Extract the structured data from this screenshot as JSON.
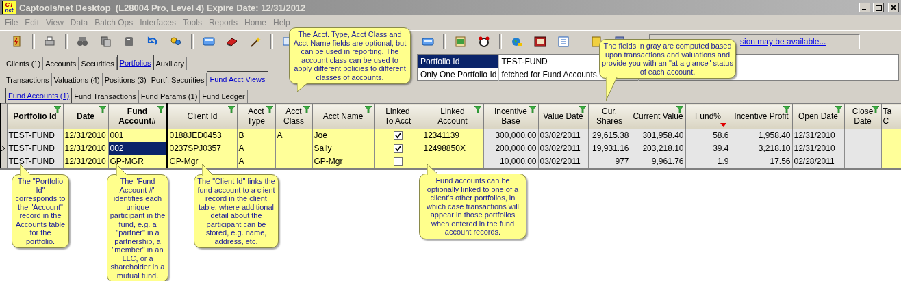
{
  "window": {
    "logo": {
      "top": "CT",
      "bottom": "net"
    },
    "title": "Captools/net Desktop  (L28004 Pro, Level 4) Expire Date: 12/31/2012"
  },
  "menu": [
    "File",
    "Edit",
    "View",
    "Data",
    "Batch Ops",
    "Interfaces",
    "Tools",
    "Reports",
    "Home",
    "Help"
  ],
  "update_link": "sion may be available...",
  "main_tabs": [
    {
      "label": "Clients (1)",
      "selected": false
    },
    {
      "label": "Accounts",
      "selected": false
    },
    {
      "label": "Securities",
      "selected": false
    },
    {
      "label": "Portfolios",
      "selected": true
    },
    {
      "label": "Auxiliary",
      "selected": false
    }
  ],
  "portfolio_tabs": [
    {
      "label": "Transactions",
      "selected": false
    },
    {
      "label": "Valuations (4)",
      "selected": false
    },
    {
      "label": "Positions (3)",
      "selected": false
    },
    {
      "label": "Portf. Securities",
      "selected": false
    },
    {
      "label": "Fund Acct Views",
      "selected": true
    }
  ],
  "info_panel": [
    {
      "label": "Portfolio Id",
      "value": "TEST-FUND",
      "selected": true
    },
    {
      "label": "Only One Portfolio Id",
      "value": "fetched for Fund Accounts.",
      "selected": false
    }
  ],
  "fund_tabs": [
    {
      "label": "Fund Accounts (1)",
      "selected": true
    },
    {
      "label": "Fund Transactions",
      "selected": false
    },
    {
      "label": "Fund Params (1)",
      "selected": false
    },
    {
      "label": "Fund Ledger",
      "selected": false
    }
  ],
  "table": {
    "columns": [
      {
        "lines": [
          "Portfolio Id"
        ],
        "key": true,
        "filter": true,
        "computed": true,
        "kind": "text"
      },
      {
        "lines": [
          "Date"
        ],
        "key": true,
        "filter": true,
        "computed": false,
        "kind": "text"
      },
      {
        "lines": [
          "Fund",
          "Account#"
        ],
        "key": true,
        "filter": true,
        "computed": false,
        "kind": "text"
      },
      {
        "lines": [
          "Client Id"
        ],
        "key": false,
        "filter": true,
        "computed": false,
        "kind": "text"
      },
      {
        "lines": [
          "Acct",
          "Type"
        ],
        "key": false,
        "filter": true,
        "computed": false,
        "kind": "text"
      },
      {
        "lines": [
          "Acct",
          "Class"
        ],
        "key": false,
        "filter": true,
        "computed": false,
        "kind": "text"
      },
      {
        "lines": [
          "Acct Name"
        ],
        "key": false,
        "filter": true,
        "computed": false,
        "kind": "text"
      },
      {
        "lines": [
          "Linked",
          "To Acct"
        ],
        "key": false,
        "filter": false,
        "computed": false,
        "kind": "check"
      },
      {
        "lines": [
          "Linked",
          "Account"
        ],
        "key": false,
        "filter": true,
        "computed": false,
        "kind": "text"
      },
      {
        "lines": [
          "Incentive",
          "Base"
        ],
        "key": false,
        "filter": true,
        "computed": true,
        "kind": "number"
      },
      {
        "lines": [
          "Value Date"
        ],
        "key": false,
        "filter": true,
        "computed": true,
        "kind": "text"
      },
      {
        "lines": [
          "Cur.",
          "Shares"
        ],
        "key": false,
        "filter": false,
        "computed": true,
        "kind": "number"
      },
      {
        "lines": [
          "Current Value"
        ],
        "key": false,
        "filter": true,
        "computed": true,
        "kind": "number"
      },
      {
        "lines": [
          "Fund%"
        ],
        "key": false,
        "filter": false,
        "sorted_descending": true,
        "computed": true,
        "kind": "number"
      },
      {
        "lines": [
          "Incentive Profit"
        ],
        "key": false,
        "filter": true,
        "computed": true,
        "kind": "number"
      },
      {
        "lines": [
          "Open Date"
        ],
        "key": false,
        "filter": true,
        "computed": true,
        "kind": "text"
      },
      {
        "lines": [
          "Close",
          "Date"
        ],
        "key": false,
        "filter": true,
        "computed": true,
        "kind": "text"
      },
      {
        "lines": [
          "Ta",
          "C"
        ],
        "key": false,
        "filter": false,
        "computed": false,
        "kind": "text"
      }
    ],
    "rows": [
      {
        "current": false,
        "cells": [
          {
            "text": "TEST-FUND",
            "selected": false
          },
          {
            "text": "12/31/2010",
            "selected": false
          },
          {
            "text": "001",
            "selected": false
          },
          {
            "text": "0188JED0453",
            "selected": false
          },
          {
            "text": "B",
            "selected": false
          },
          {
            "text": "A",
            "selected": false
          },
          {
            "text": "Joe",
            "selected": false
          },
          {
            "checked": true,
            "selected": false
          },
          {
            "text": "12341139",
            "selected": false
          },
          {
            "text": "300,000.00",
            "selected": false
          },
          {
            "text": "03/02/2011",
            "selected": false
          },
          {
            "text": "29,615.38",
            "selected": false
          },
          {
            "text": "301,958.40",
            "selected": false
          },
          {
            "text": "58.6",
            "selected": false
          },
          {
            "text": "1,958.40",
            "selected": false
          },
          {
            "text": "12/31/2010",
            "selected": false
          },
          {
            "selected": false
          },
          {
            "selected": false
          }
        ]
      },
      {
        "current": true,
        "cells": [
          {
            "text": "TEST-FUND",
            "selected": false
          },
          {
            "text": "12/31/2010",
            "selected": false
          },
          {
            "text": "002",
            "selected": true
          },
          {
            "text": "0237SPJ0357",
            "selected": false
          },
          {
            "text": "A",
            "selected": false
          },
          {
            "selected": false
          },
          {
            "text": "Sally",
            "selected": false
          },
          {
            "checked": true,
            "selected": false
          },
          {
            "text": "12498850X",
            "selected": false
          },
          {
            "text": "200,000.00",
            "selected": false
          },
          {
            "text": "03/02/2011",
            "selected": false
          },
          {
            "text": "19,931.16",
            "selected": false
          },
          {
            "text": "203,218.10",
            "selected": false
          },
          {
            "text": "39.4",
            "selected": false
          },
          {
            "text": "3,218.10",
            "selected": false
          },
          {
            "text": "12/31/2010",
            "selected": false
          },
          {
            "selected": false
          },
          {
            "selected": false
          }
        ]
      },
      {
        "current": false,
        "cells": [
          {
            "text": "TEST-FUND",
            "selected": false
          },
          {
            "text": "12/31/2010",
            "selected": false
          },
          {
            "text": "GP-MGR",
            "selected": false
          },
          {
            "text": "GP-Mgr",
            "selected": false
          },
          {
            "text": "A",
            "selected": false
          },
          {
            "selected": false
          },
          {
            "text": "GP-Mgr",
            "selected": false
          },
          {
            "checked": false,
            "selected": false
          },
          {
            "selected": false
          },
          {
            "text": "10,000.00",
            "selected": false
          },
          {
            "text": "03/02/2011",
            "selected": false
          },
          {
            "text": "977",
            "selected": false
          },
          {
            "text": "9,961.76",
            "selected": false
          },
          {
            "text": "1.9",
            "selected": false
          },
          {
            "text": "17.56",
            "selected": false
          },
          {
            "text": "02/28/2011",
            "selected": false
          },
          {
            "selected": false
          },
          {
            "selected": false
          }
        ]
      }
    ]
  },
  "callouts": [
    {
      "text": "The Acct. Type, Acct Class and Acct Name fields are optional, but can be used in reporting. The account class can be used to apply different policies to different classes of accounts."
    },
    {
      "text": "The fields in gray are computed based upon transactions and valuations and provide you with an \"at a glance\" status of each account."
    },
    {
      "text": "The \"Portfolio Id\" corresponds to the \"Account\" record in the Accounts table for the portfolio."
    },
    {
      "text": "The \"Fund Account #\" identifies each unique participant in the fund, e.g. a \"partner\" in a partnership, a \"member\" in an LLC, or a shareholder in a mutual fund."
    },
    {
      "text": "The \"Client Id\" links the fund account to a client record in the client table, where additional detail about the participant can be stored, e.g. name, address, etc."
    },
    {
      "text": "Fund accounts can be optionally linked to one of a client's other portfolios, in which case transactions will appear in those portfolios when entered in the fund account records."
    }
  ]
}
